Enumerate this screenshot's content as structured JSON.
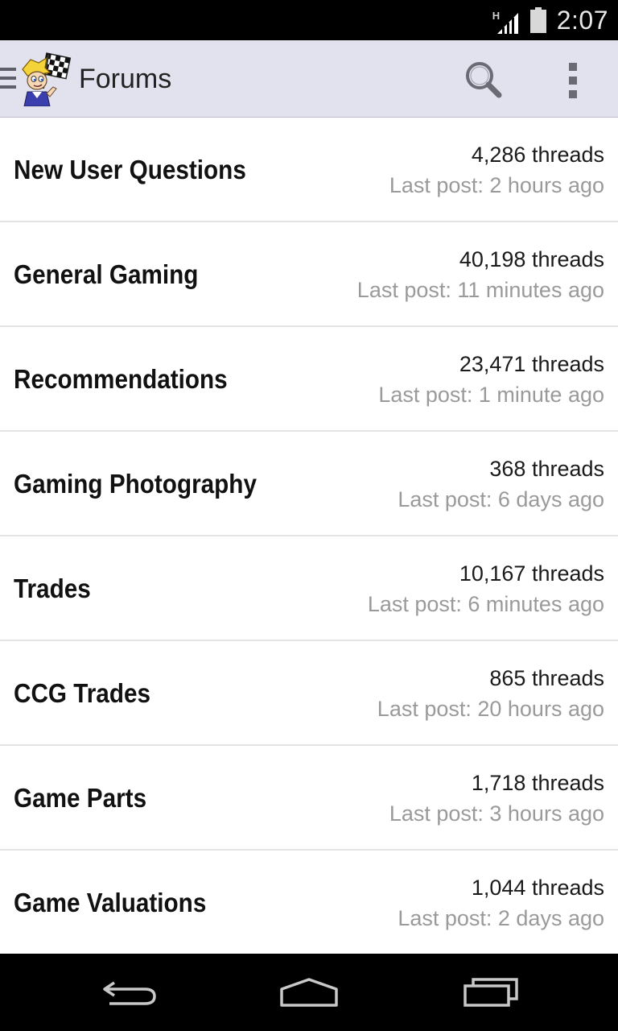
{
  "status_bar": {
    "network_type": "H",
    "time": "2:07",
    "icons": [
      "signal-icon",
      "battery-icon"
    ]
  },
  "action_bar": {
    "title": "Forums",
    "icons": [
      "drawer-icon",
      "app-logo-icon",
      "search-icon",
      "overflow-menu-icon"
    ]
  },
  "forums": [
    {
      "name": "New User Questions",
      "threads": "4,286 threads",
      "last_post": "Last post: 2 hours ago"
    },
    {
      "name": "General Gaming",
      "threads": "40,198 threads",
      "last_post": "Last post: 11 minutes ago"
    },
    {
      "name": "Recommendations",
      "threads": "23,471 threads",
      "last_post": "Last post: 1 minute ago"
    },
    {
      "name": "Gaming Photography",
      "threads": "368 threads",
      "last_post": "Last post: 6 days ago"
    },
    {
      "name": "Trades",
      "threads": "10,167 threads",
      "last_post": "Last post: 6 minutes ago"
    },
    {
      "name": "CCG Trades",
      "threads": "865 threads",
      "last_post": "Last post: 20 hours ago"
    },
    {
      "name": "Game Parts",
      "threads": "1,718 threads",
      "last_post": "Last post: 3 hours ago"
    },
    {
      "name": "Game Valuations",
      "threads": "1,044 threads",
      "last_post": "Last post: 2 days ago"
    }
  ],
  "nav_bar": {
    "icons": [
      "back-icon",
      "home-icon",
      "recents-icon"
    ]
  },
  "colors": {
    "action_bar_bg": "#e2e2ef",
    "title_text": "#222222",
    "secondary_text": "#9a9a9a",
    "divider": "#e4e4e4"
  }
}
